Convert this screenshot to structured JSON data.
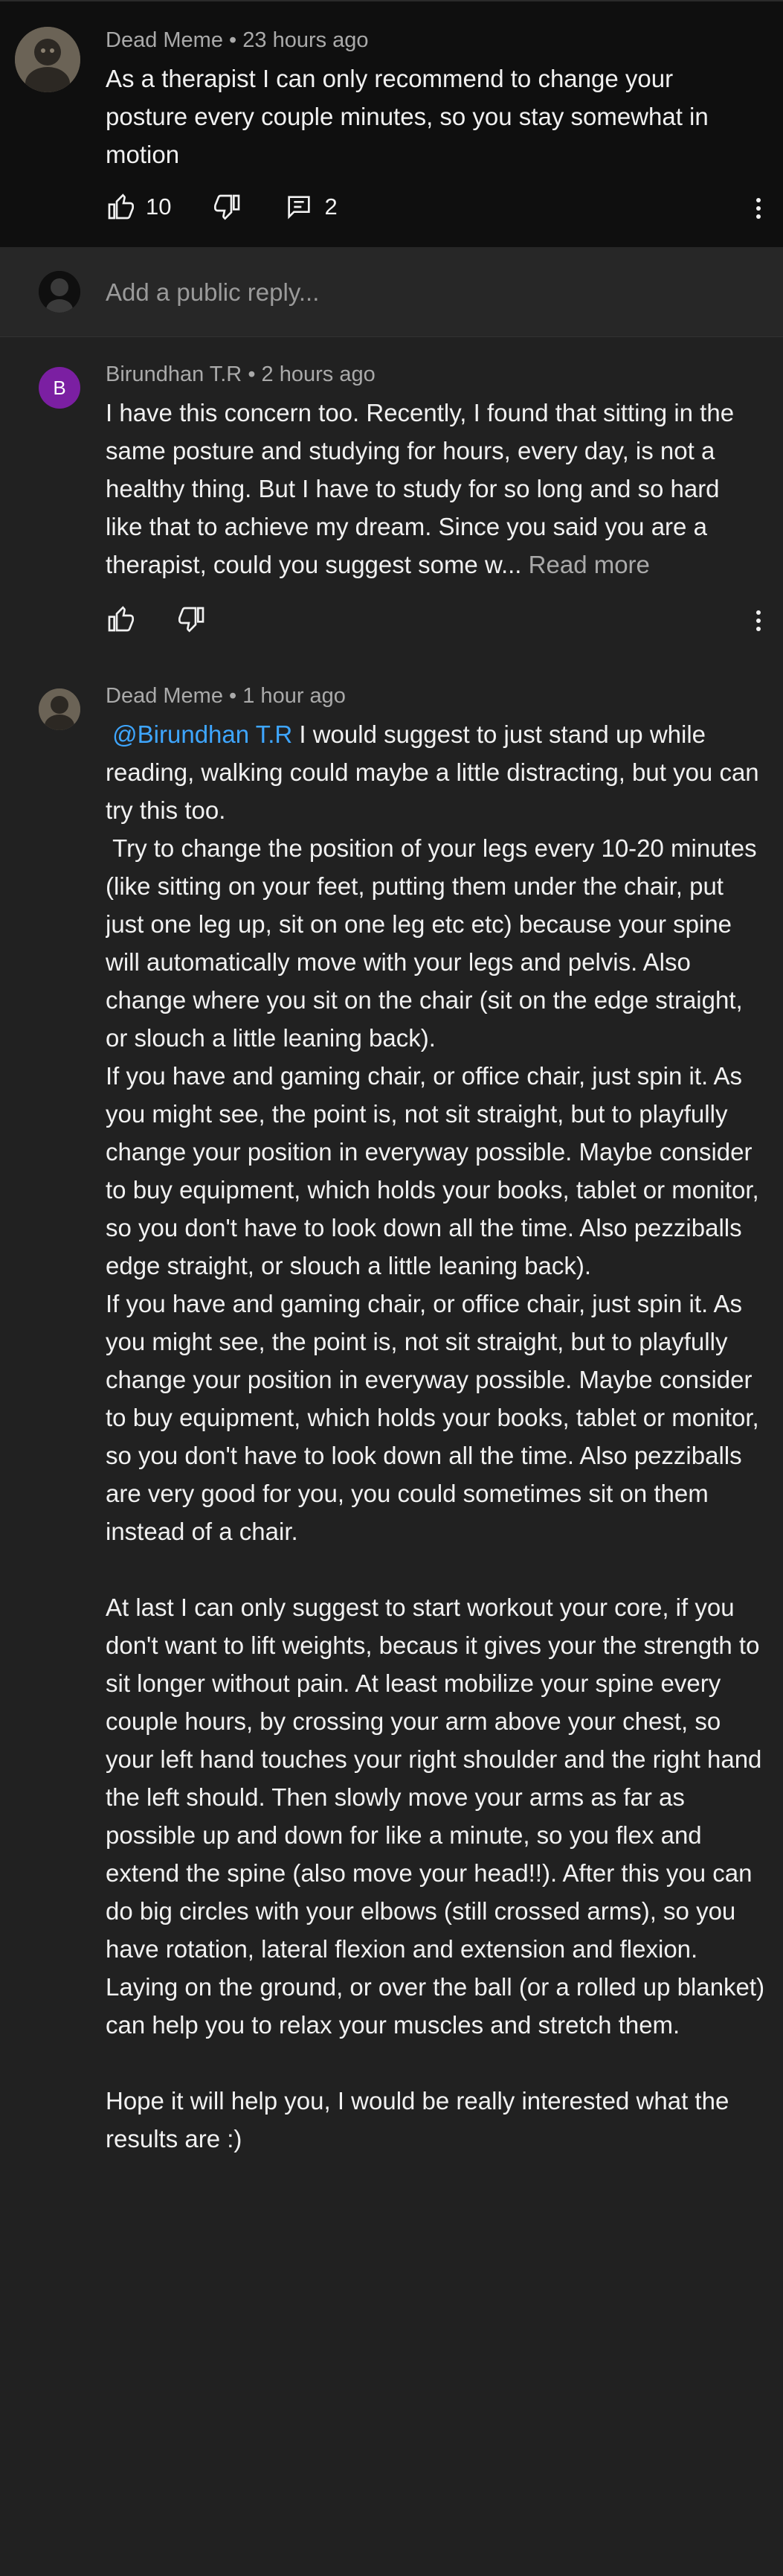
{
  "comment": {
    "author": "Dead Meme",
    "time": "23 hours ago",
    "text": "As a therapist I can only recommend to change your posture every couple minutes, so you stay somewhat in motion",
    "likes": "10",
    "replies": "2"
  },
  "reply_box": {
    "placeholder": "Add a public reply..."
  },
  "replies": [
    {
      "author": "Birundhan T.R",
      "initial": "B",
      "time": "2 hours ago",
      "text": "I have this concern too. Recently, I found that sitting in the same posture and studying for hours, every day, is not a healthy thing. But I have to study for so long and so hard like that to achieve my dream. Since you said you are a therapist, could you suggest some w...",
      "read_more": " Read more"
    },
    {
      "author": "Dead Meme",
      "time": "1 hour ago",
      "mention": "@Birundhan T.R",
      "text_part1": " I would suggest to just stand up while reading, walking could maybe a little distracting, but you can try this too.\n Try to change the position of your legs every 10-20 minutes (like sitting on your feet, putting them under the chair, put just one leg up, sit on one leg etc etc) because your spine will automatically move with your legs and pelvis. Also change where you sit on the chair (sit on the edge straight, or slouch a little leaning back).\nIf you have and gaming chair, or office chair, just spin it. As you might see, the point is, not sit straight, but to playfully change your position in everyway possible. Maybe consider to buy equipment, which holds your books, tablet or monitor, so you don't have to look down all the time. Also pezziballs are very good for you, you could sometimes sit on them instead of a chair.\n\nAt last I can only suggest to start workout your core, if you don't want to lift weights, becaus it gives your the strength to sit longer without pain. At least mobilize your spine every couple hours, by crossing your arm above your chest, so your left hand touches your right shoulder and the right hand the left should. Then slowly move your arms as far as possible up and down for like a",
      "text_part2": "edge straight, or slouch a little leaning back).\nIf you have and gaming chair, or office chair, just spin it. As you might see, the point is, not sit straight, but to playfully change your position in everyway possible. Maybe consider to buy equipment, which holds your books, tablet or monitor, so you don't have to look down all the time. Also pezziballs are very good for you, you could sometimes sit on them instead of a chair.\n\nAt last I can only suggest to start workout your core, if you don't want to lift weights, becaus it gives your the strength to sit longer without pain. At least mobilize your spine every couple hours, by crossing your arm above your chest, so your left hand touches your right shoulder and the right hand the left should. Then slowly move your arms as far as possible up and down for like a minute, so you flex and extend the spine (also move your head!!). After this you can do big circles with your elbows (still crossed arms), so you have rotation, lateral flexion and extension and flexion. Laying on the ground, or over the ball (or a rolled up blanket) can help you to relax your muscles and stretch them.\n\nHope it will help you, I would be really interested what the results are :)"
    }
  ]
}
